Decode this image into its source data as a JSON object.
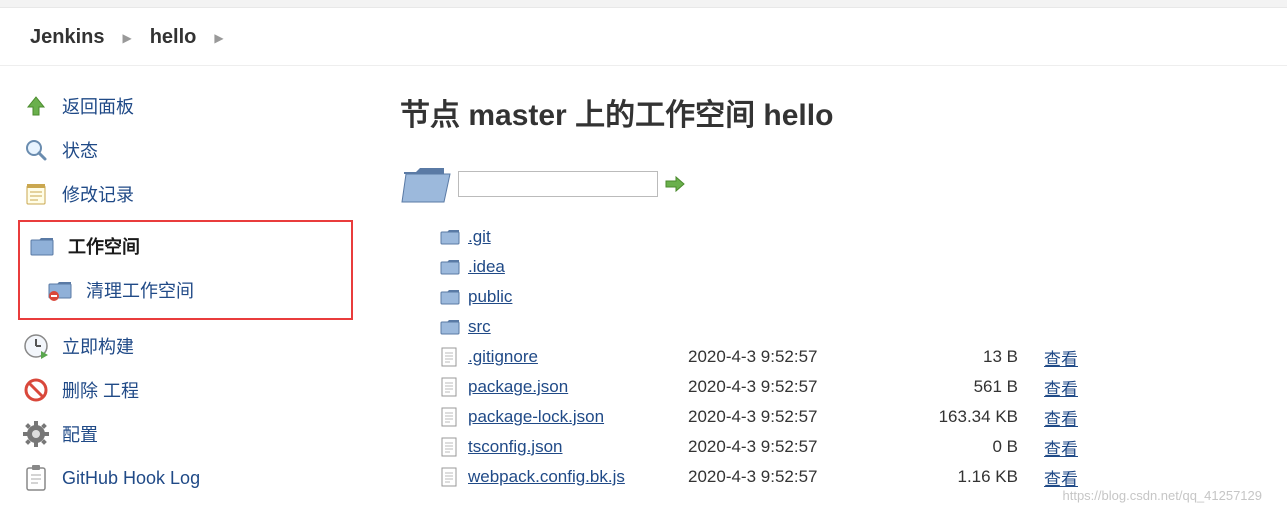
{
  "breadcrumbs": [
    "Jenkins",
    "hello"
  ],
  "sidebar": {
    "back": "返回面板",
    "status": "状态",
    "changes": "修改记录",
    "workspace": "工作空间",
    "wipe": "清理工作空间",
    "build": "立即构建",
    "delete": "删除 工程",
    "configure": "配置",
    "github": "GitHub Hook Log"
  },
  "main": {
    "title": "节点 master 上的工作空间 hello",
    "path_value": "",
    "folders": [
      ".git",
      ".idea",
      "public",
      "src"
    ],
    "files": [
      {
        "name": ".gitignore",
        "date": "2020-4-3 9:52:57",
        "size": "13 B",
        "view": "查看"
      },
      {
        "name": "package.json",
        "date": "2020-4-3 9:52:57",
        "size": "561 B",
        "view": "查看"
      },
      {
        "name": "package-lock.json",
        "date": "2020-4-3 9:52:57",
        "size": "163.34 KB",
        "view": "查看"
      },
      {
        "name": "tsconfig.json",
        "date": "2020-4-3 9:52:57",
        "size": "0 B",
        "view": "查看"
      },
      {
        "name": "webpack.config.bk.js",
        "date": "2020-4-3 9:52:57",
        "size": "1.16 KB",
        "view": "查看"
      }
    ]
  },
  "watermark": "https://blog.csdn.net/qq_41257129"
}
